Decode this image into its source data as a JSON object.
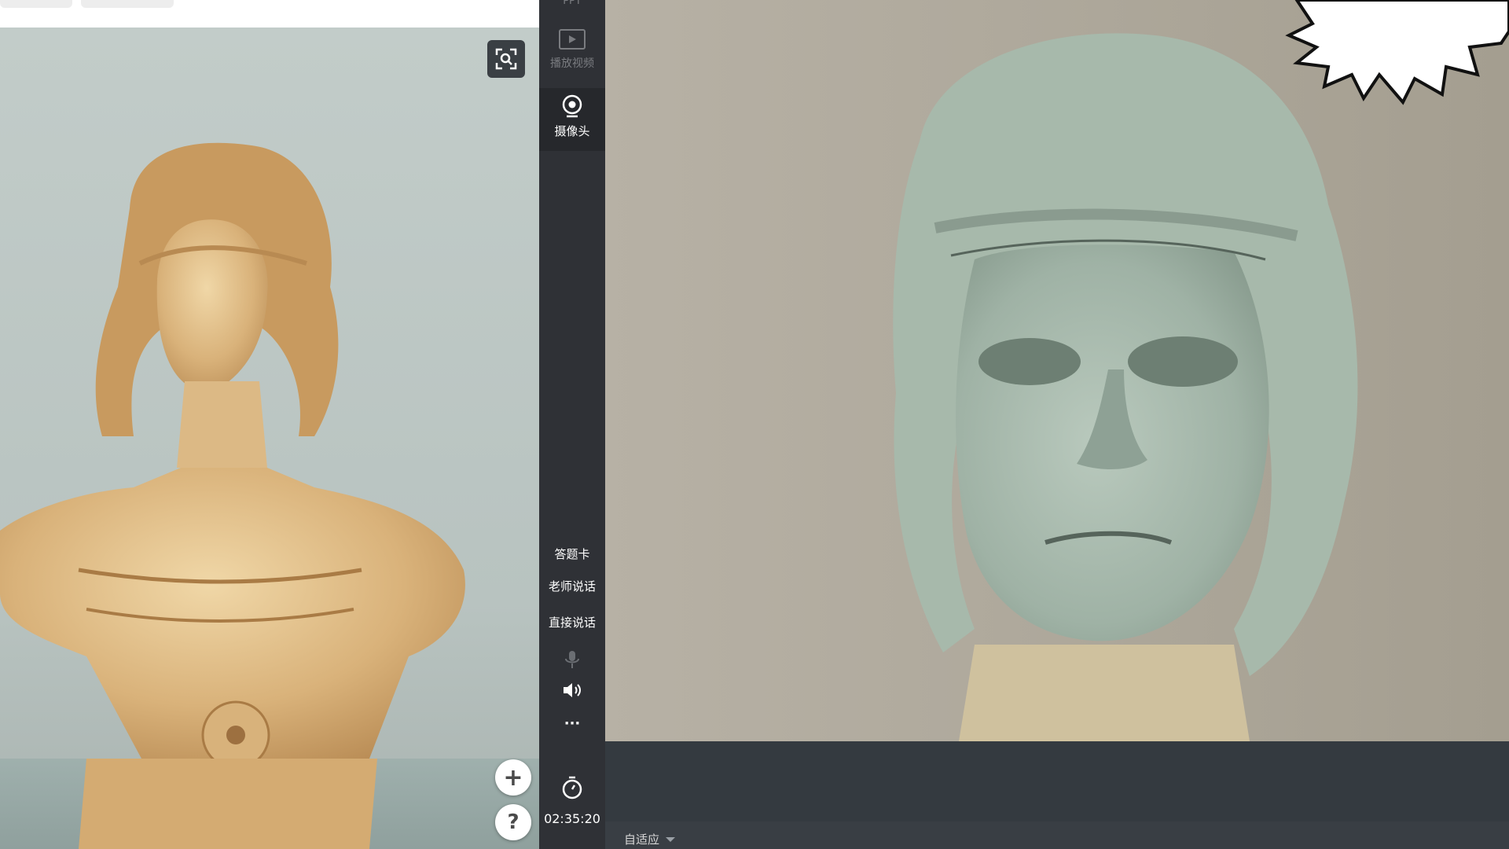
{
  "toolbar": {
    "ppt_label": "PPT",
    "play_video_label": "播放视频",
    "camera_label": "摄像头",
    "answer_card_label": "答题卡",
    "teacher_speak_label": "老师说话",
    "direct_speak_label": "直接说话",
    "more_label": "···",
    "timer": "02:35:20"
  },
  "left_panel": {
    "add_label": "+",
    "help_label": "?"
  },
  "status": {
    "fit_label": "自适应"
  },
  "icons": [
    "zoom-search-icon",
    "play-video-icon",
    "camera-icon",
    "microphone-icon",
    "speaker-icon",
    "timer-icon",
    "caret-down-icon"
  ],
  "colors": {
    "toolbar_bg": "#2f3136",
    "bottom_bar_bg": "#343a40"
  }
}
